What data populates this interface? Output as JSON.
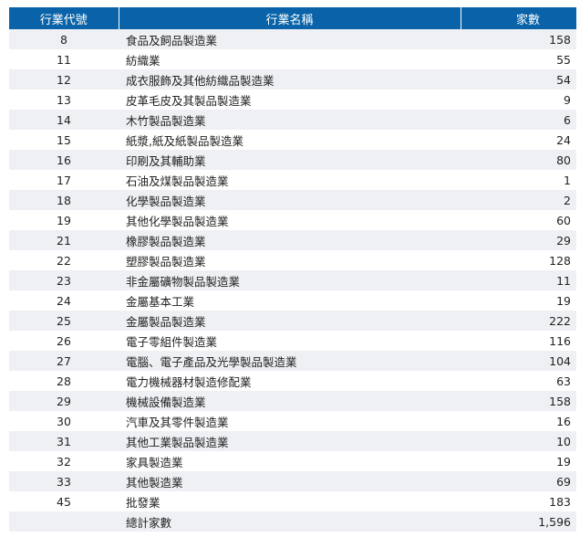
{
  "headers": {
    "code": "行業代號",
    "name": "行業名稱",
    "count": "家數"
  },
  "rows": [
    {
      "code": "8",
      "name": "食品及飼品製造業",
      "count": "158"
    },
    {
      "code": "11",
      "name": "紡織業",
      "count": "55"
    },
    {
      "code": "12",
      "name": "成衣服飾及其他紡織品製造業",
      "count": "54"
    },
    {
      "code": "13",
      "name": "皮革毛皮及其製品製造業",
      "count": "9"
    },
    {
      "code": "14",
      "name": "木竹製品製造業",
      "count": "6"
    },
    {
      "code": "15",
      "name": "紙漿,紙及紙製品製造業",
      "count": "24"
    },
    {
      "code": "16",
      "name": "印刷及其輔助業",
      "count": "80"
    },
    {
      "code": "17",
      "name": "石油及煤製品製造業",
      "count": "1"
    },
    {
      "code": "18",
      "name": "化學製品製造業",
      "count": "2"
    },
    {
      "code": "19",
      "name": "其他化學製品製造業",
      "count": "60"
    },
    {
      "code": "21",
      "name": "橡膠製品製造業",
      "count": "29"
    },
    {
      "code": "22",
      "name": "塑膠製品製造業",
      "count": "128"
    },
    {
      "code": "23",
      "name": "非金屬礦物製品製造業",
      "count": "11"
    },
    {
      "code": "24",
      "name": "金屬基本工業",
      "count": "19"
    },
    {
      "code": "25",
      "name": "金屬製品製造業",
      "count": "222"
    },
    {
      "code": "26",
      "name": "電子零組件製造業",
      "count": "116"
    },
    {
      "code": "27",
      "name": "電腦、電子產品及光學製品製造業",
      "count": "104"
    },
    {
      "code": "28",
      "name": "電力機械器材製造修配業",
      "count": "63"
    },
    {
      "code": "29",
      "name": "機械設備製造業",
      "count": "158"
    },
    {
      "code": "30",
      "name": "汽車及其零件製造業",
      "count": "16"
    },
    {
      "code": "31",
      "name": "其他工業製品製造業",
      "count": "10"
    },
    {
      "code": "32",
      "name": "家具製造業",
      "count": "19"
    },
    {
      "code": "33",
      "name": "其他製造業",
      "count": "69"
    },
    {
      "code": "45",
      "name": "批發業",
      "count": "183"
    }
  ],
  "total": {
    "code": "",
    "name": "總計家數",
    "count": "1,596"
  }
}
